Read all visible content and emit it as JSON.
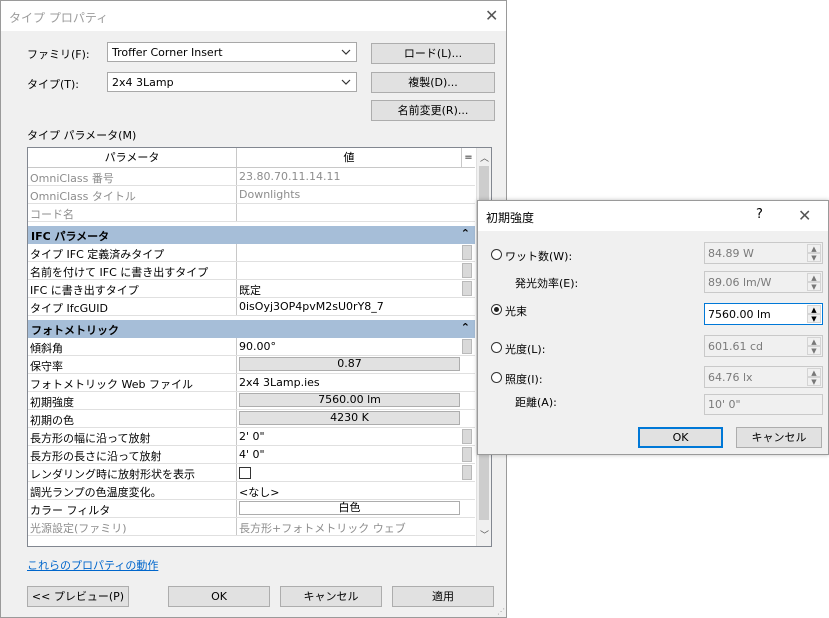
{
  "main_dialog": {
    "title": "タイプ プロパティ",
    "family_label": "ファミリ(F):",
    "family_value": "Troffer Corner Insert",
    "type_label": "タイプ(T):",
    "type_value": "2x4 3Lamp",
    "load_button": "ロード(L)...",
    "duplicate_button": "複製(D)...",
    "rename_button": "名前変更(R)...",
    "type_params_label": "タイプ パラメータ(M)",
    "grid": {
      "header_param": "パラメータ",
      "header_value": "値",
      "header_eq": "=",
      "rows_top": [
        {
          "param": "OmniClass 番号",
          "value": "23.80.70.11.14.11"
        },
        {
          "param": "OmniClass タイトル",
          "value": "Downlights"
        },
        {
          "param": "コード名",
          "value": ""
        }
      ],
      "ifc_group": "IFC パラメータ",
      "rows_ifc": [
        {
          "param": "タイプ IFC 定義済みタイプ",
          "value": ""
        },
        {
          "param": "名前を付けて IFC に書き出すタイプ",
          "value": ""
        },
        {
          "param": "IFC に書き出すタイプ",
          "value": "既定"
        },
        {
          "param": "タイプ IfcGUID",
          "value": "0isOyj3OP4pvM2sU0rY8_7"
        }
      ],
      "photo_group": "フォトメトリック",
      "rows_photo": [
        {
          "param": "傾斜角",
          "value": "90.00°"
        },
        {
          "param": "保守率",
          "value": "0.87"
        },
        {
          "param": "フォトメトリック Web ファイル",
          "value": "2x4 3Lamp.ies"
        },
        {
          "param": "初期強度",
          "value": "7560.00 lm"
        },
        {
          "param": "初期の色",
          "value": "4230 K"
        },
        {
          "param": "長方形の幅に沿って放射",
          "value": "2'  0\""
        },
        {
          "param": "長方形の長さに沿って放射",
          "value": "4'  0\""
        },
        {
          "param": "レンダリング時に放射形状を表示",
          "value": ""
        },
        {
          "param": "調光ランプの色温度変化。",
          "value": "<なし>"
        },
        {
          "param": "カラー フィルタ",
          "value": "白色"
        },
        {
          "param": "光源設定(ファミリ)",
          "value": "長方形+フォトメトリック ウェブ"
        }
      ]
    },
    "help_link": "これらのプロパティの動作",
    "preview_button": "<< プレビュー(P)",
    "ok_button": "OK",
    "cancel_button": "キャンセル",
    "apply_button": "適用"
  },
  "intensity_dialog": {
    "title": "初期強度",
    "help": "?",
    "wattage_label": "ワット数(W):",
    "wattage_value": "84.89 W",
    "efficacy_label": "発光効率(E):",
    "efficacy_value": "89.06 lm/W",
    "flux_label": "光束",
    "flux_value": "7560.00 lm",
    "intensity_label": "光度(L):",
    "intensity_value": "601.61 cd",
    "illuminance_label": "照度(I):",
    "illuminance_value": "64.76 lx",
    "distance_label": "距離(A):",
    "distance_value": "10'  0\"",
    "selected_option": "光束",
    "ok_button": "OK",
    "cancel_button": "キャンセル"
  }
}
